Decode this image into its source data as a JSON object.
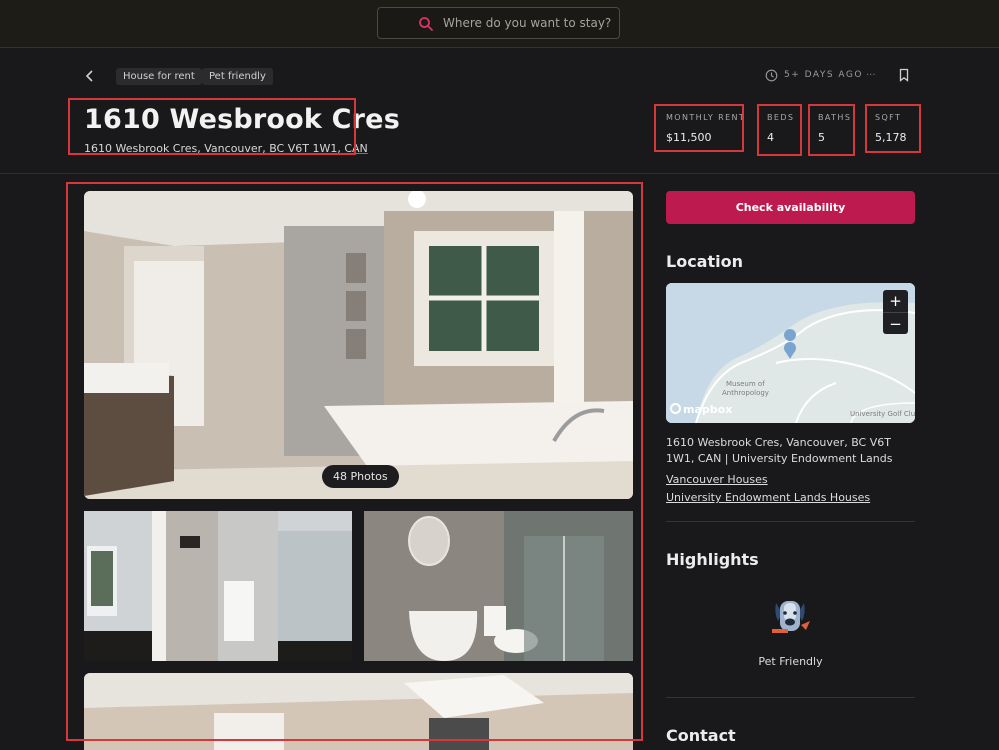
{
  "search": {
    "placeholder": "Where do you want to stay?"
  },
  "tags": [
    "House for rent",
    "Pet friendly"
  ],
  "posted": "5+ DAYS AGO",
  "more": "...",
  "listing": {
    "title": "1610 Wesbrook Cres",
    "address": "1610 Wesbrook Cres, Vancouver, BC V6T 1W1, CAN"
  },
  "stats": [
    {
      "label": "MONTHLY RENT",
      "value": "$11,500"
    },
    {
      "label": "BEDS",
      "value": "4"
    },
    {
      "label": "BATHS",
      "value": "5"
    },
    {
      "label": "SQFT",
      "value": "5,178"
    }
  ],
  "gallery": {
    "count_label": "48 Photos"
  },
  "cta": {
    "label": "Check availability"
  },
  "location": {
    "heading": "Location",
    "zoom_in": "+",
    "zoom_out": "−",
    "map_logo": "mapbox",
    "map_labels": [
      "Museum of",
      "Anthropology",
      "University Golf Clu"
    ],
    "address_line": "1610 Wesbrook Cres, Vancouver, BC V6T 1W1, CAN  |  University Endowment Lands",
    "links": [
      "Vancouver Houses",
      "University Endowment Lands Houses"
    ]
  },
  "highlights": {
    "heading": "Highlights",
    "items": [
      {
        "label": "Pet Friendly",
        "icon": "dog-icon"
      }
    ]
  },
  "contact": {
    "heading": "Contact"
  },
  "colors": {
    "accent": "#bd1a50",
    "annotation": "#d6373b",
    "background": "#19191b"
  }
}
